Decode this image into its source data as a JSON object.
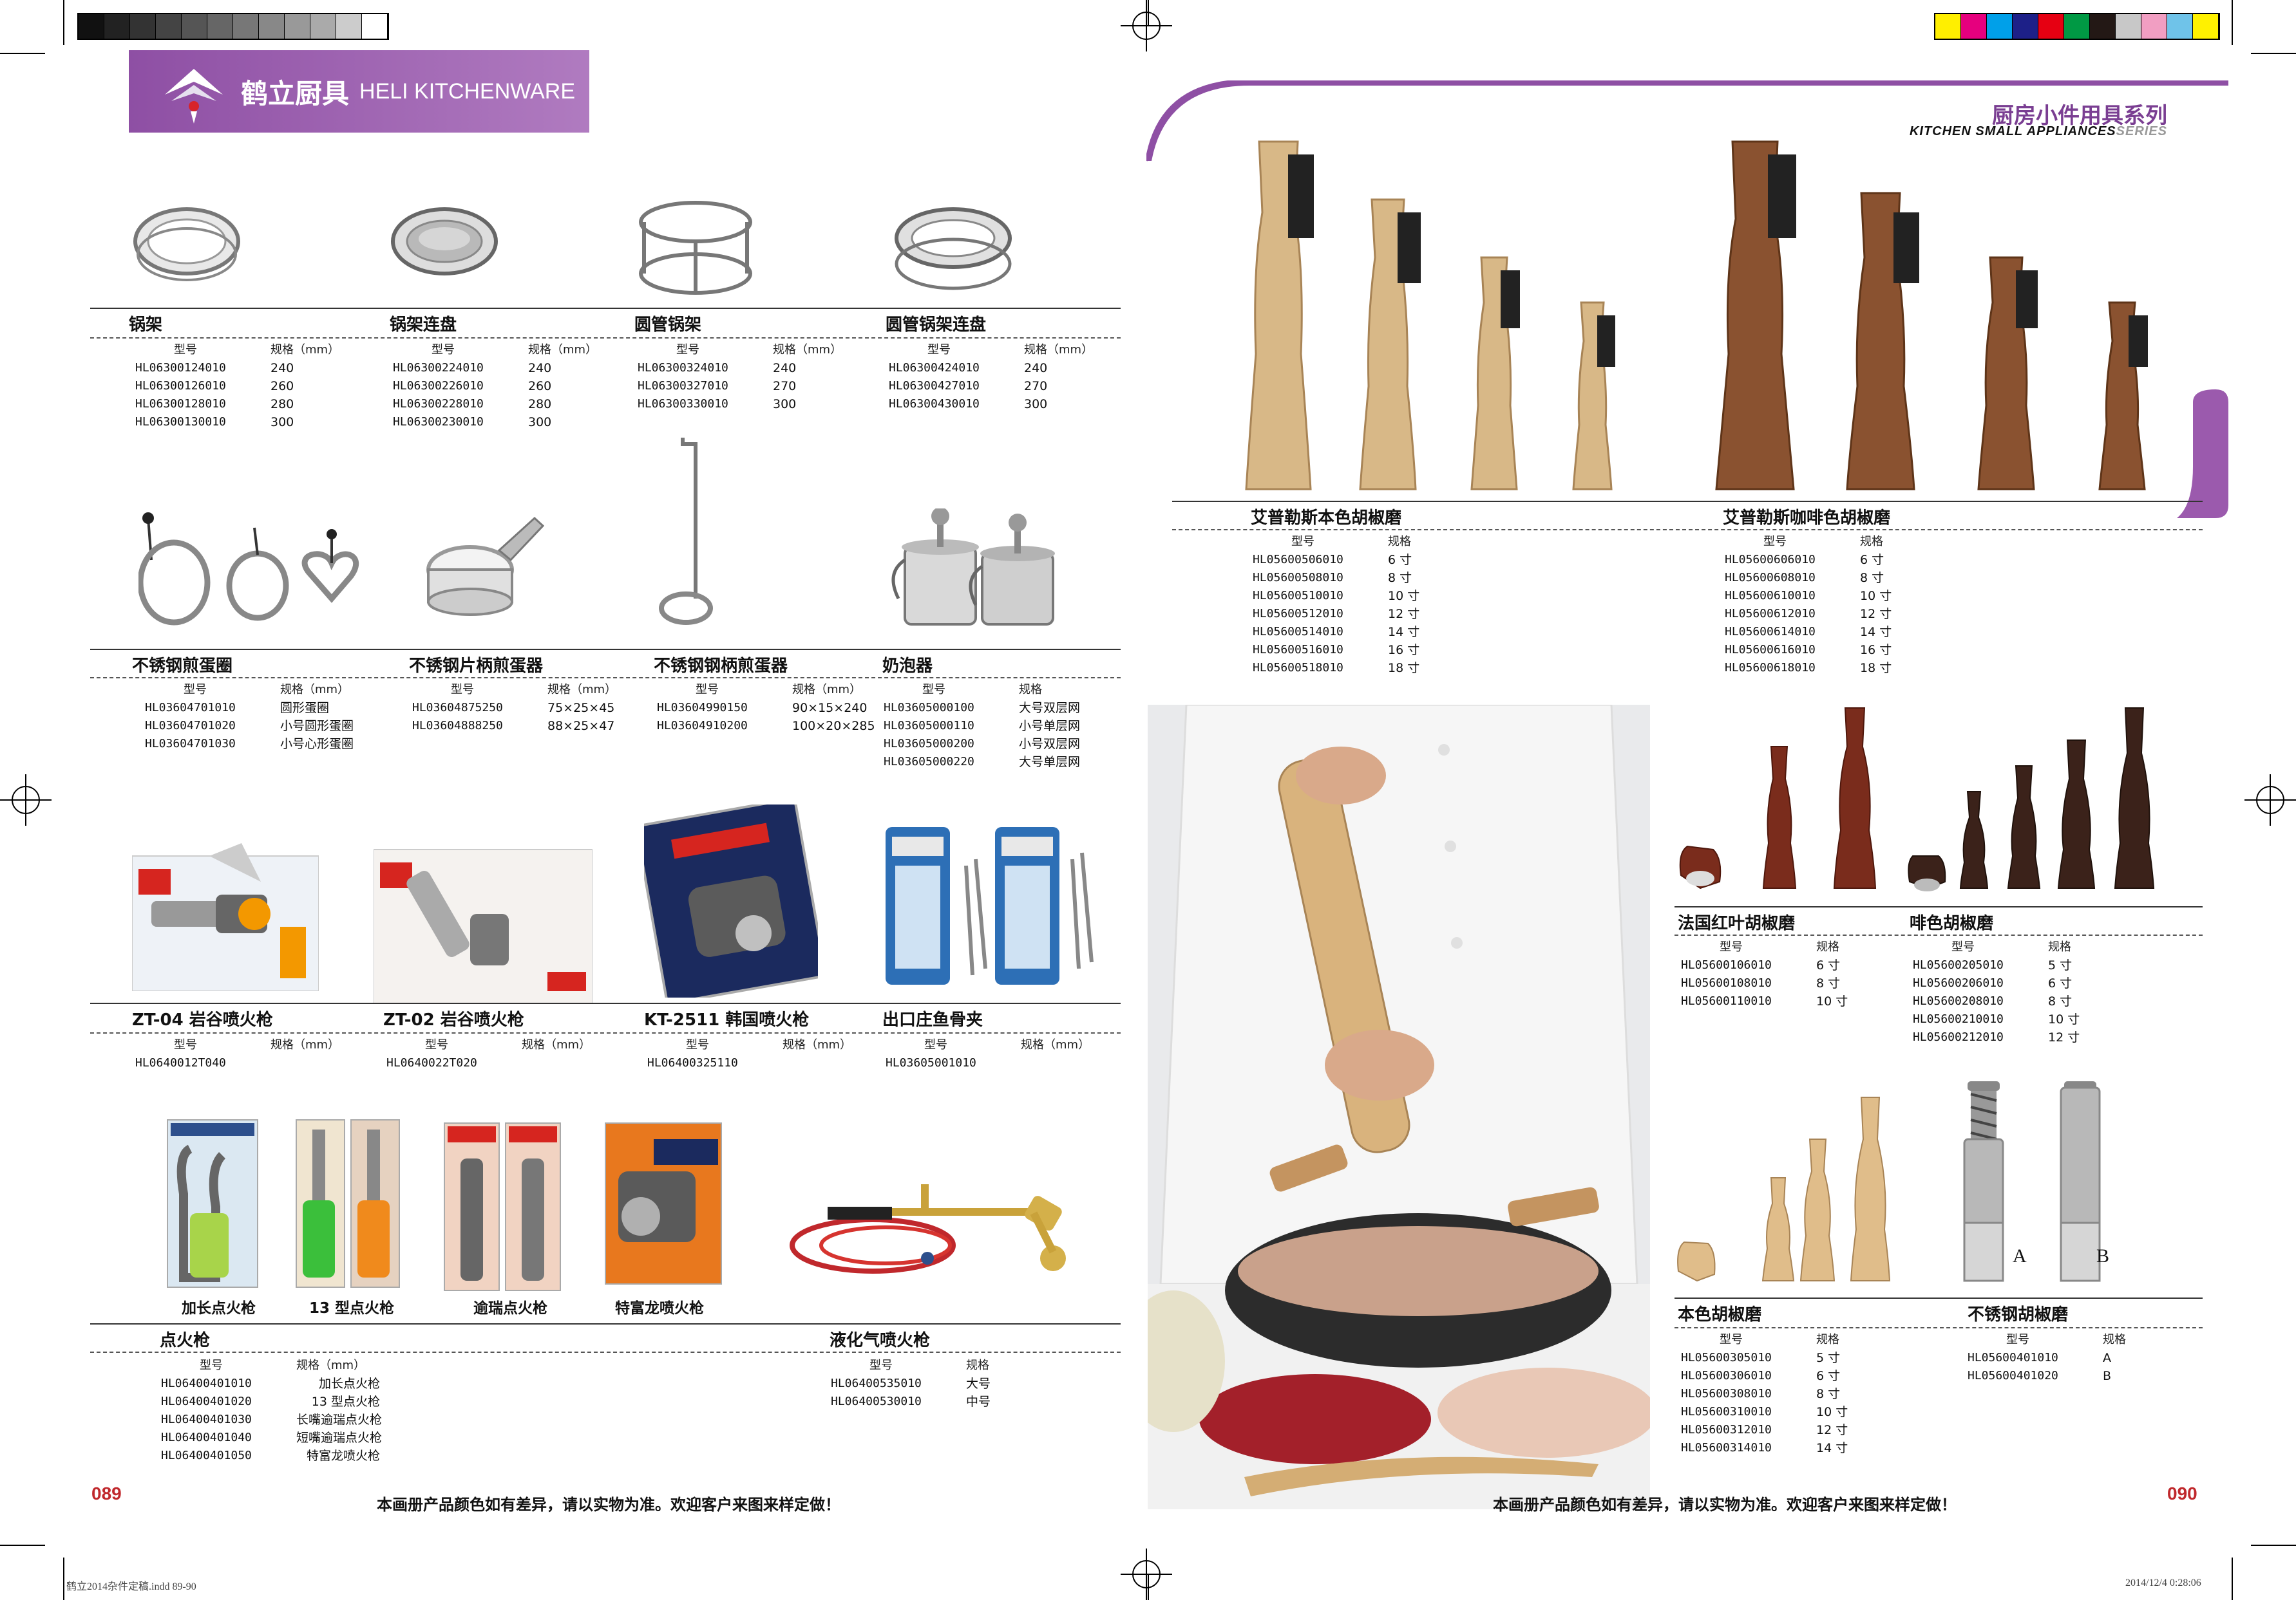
{
  "brand": {
    "name_cn": "鹤立厨具",
    "name_en": "HELI KITCHENWARE"
  },
  "series": {
    "title_cn": "厨房小件用具系列",
    "title_en": "KITCHEN SMALL APPLIANCES",
    "title_en_suffix": "SERIES"
  },
  "colors": {
    "accent": "#8e4fa4",
    "page_number": "#c0282c"
  },
  "spec_headers": {
    "model": "型号",
    "size_mm": "规格（mm）",
    "size": "规格"
  },
  "products": {
    "wok_rack": {
      "name": "锅架",
      "rows": [
        [
          "HL06300124010",
          "240"
        ],
        [
          "HL06300126010",
          "260"
        ],
        [
          "HL06300128010",
          "280"
        ],
        [
          "HL06300130010",
          "300"
        ]
      ]
    },
    "wok_rack_tray": {
      "name": "锅架连盘",
      "rows": [
        [
          "HL06300224010",
          "240"
        ],
        [
          "HL06300226010",
          "260"
        ],
        [
          "HL06300228010",
          "280"
        ],
        [
          "HL06300230010",
          "300"
        ]
      ]
    },
    "round_tube_rack": {
      "name": "圆管锅架",
      "rows": [
        [
          "HL06300324010",
          "240"
        ],
        [
          "HL06300327010",
          "270"
        ],
        [
          "HL06300330010",
          "300"
        ]
      ]
    },
    "round_tube_rack_tray": {
      "name": "圆管锅架连盘",
      "rows": [
        [
          "HL06300424010",
          "240"
        ],
        [
          "HL06300427010",
          "270"
        ],
        [
          "HL06300430010",
          "300"
        ]
      ]
    },
    "egg_ring": {
      "name": "不锈钢煎蛋圈",
      "rows": [
        [
          "HL03604701010",
          "圆形蛋圈"
        ],
        [
          "HL03604701020",
          "小号圆形蛋圈"
        ],
        [
          "HL03604701030",
          "小号心形蛋圈"
        ]
      ]
    },
    "egg_fryer_handle": {
      "name": "不锈钢片柄煎蛋器",
      "rows": [
        [
          "HL03604875250",
          "75×25×45"
        ],
        [
          "HL03604888250",
          "88×25×47"
        ]
      ]
    },
    "egg_fryer_long": {
      "name": "不锈钢钢柄煎蛋器",
      "rows": [
        [
          "HL03604990150",
          "90×15×240"
        ],
        [
          "HL03604910200",
          "100×20×285"
        ]
      ]
    },
    "milk_frother": {
      "name": "奶泡器",
      "rows": [
        [
          "HL03605000100",
          "大号双层网"
        ],
        [
          "HL03605000110",
          "小号单层网"
        ],
        [
          "HL03605000200",
          "小号双层网"
        ],
        [
          "HL03605000220",
          "大号单层网"
        ]
      ]
    },
    "torch_zt04": {
      "name": "ZT-04 岩谷喷火枪",
      "rows": [
        [
          "HL0640012T040",
          ""
        ]
      ]
    },
    "torch_zt02": {
      "name": "ZT-02 岩谷喷火枪",
      "rows": [
        [
          "HL0640022T020",
          ""
        ]
      ]
    },
    "torch_kt2511": {
      "name": "KT-2511 韩国喷火枪",
      "rows": [
        [
          "HL06400325110",
          ""
        ]
      ]
    },
    "fish_bone_clip": {
      "name": "出口庄鱼骨夹",
      "rows": [
        [
          "HL03605001010",
          ""
        ]
      ]
    },
    "lighter_captions": [
      "加长点火枪",
      "13 型点火枪",
      "逾瑞点火枪",
      "特富龙喷火枪"
    ],
    "lighter": {
      "name": "点火枪",
      "rows": [
        [
          "HL06400401010",
          "加长点火枪"
        ],
        [
          "HL06400401020",
          "13 型点火枪"
        ],
        [
          "HL06400401030",
          "长嘴逾瑞点火枪"
        ],
        [
          "HL06400401040",
          "短嘴逾瑞点火枪"
        ],
        [
          "HL06400401050",
          "特富龙喷火枪"
        ]
      ]
    },
    "lpg_torch": {
      "name": "液化气喷火枪",
      "rows": [
        [
          "HL06400535010",
          "大号"
        ],
        [
          "HL06400530010",
          "中号"
        ]
      ]
    },
    "natural_mill": {
      "name": "艾普勒斯本色胡椒磨",
      "rows": [
        [
          "HL05600506010",
          "6 寸"
        ],
        [
          "HL05600508010",
          "8 寸"
        ],
        [
          "HL05600510010",
          "10 寸"
        ],
        [
          "HL05600512010",
          "12 寸"
        ],
        [
          "HL05600514010",
          "14 寸"
        ],
        [
          "HL05600516010",
          "16 寸"
        ],
        [
          "HL05600518010",
          "18 寸"
        ]
      ]
    },
    "coffee_mill": {
      "name": "艾普勒斯咖啡色胡椒磨",
      "rows": [
        [
          "HL05600606010",
          "6 寸"
        ],
        [
          "HL05600608010",
          "8 寸"
        ],
        [
          "HL05600610010",
          "10 寸"
        ],
        [
          "HL05600612010",
          "12 寸"
        ],
        [
          "HL05600614010",
          "14 寸"
        ],
        [
          "HL05600616010",
          "16 寸"
        ],
        [
          "HL05600618010",
          "18 寸"
        ]
      ]
    },
    "french_red_mill": {
      "name": "法国红叶胡椒磨",
      "rows": [
        [
          "HL05600106010",
          "6 寸"
        ],
        [
          "HL05600108010",
          "8 寸"
        ],
        [
          "HL05600110010",
          "10 寸"
        ]
      ]
    },
    "coffee_color_mill": {
      "name": "啡色胡椒磨",
      "rows": [
        [
          "HL05600205010",
          "5 寸"
        ],
        [
          "HL05600206010",
          "6 寸"
        ],
        [
          "HL05600208010",
          "8 寸"
        ],
        [
          "HL05600210010",
          "10 寸"
        ],
        [
          "HL05600212010",
          "12 寸"
        ]
      ]
    },
    "plain_mill": {
      "name": "本色胡椒磨",
      "rows": [
        [
          "HL05600305010",
          "5 寸"
        ],
        [
          "HL05600306010",
          "6 寸"
        ],
        [
          "HL05600308010",
          "8 寸"
        ],
        [
          "HL05600310010",
          "10 寸"
        ],
        [
          "HL05600312010",
          "12 寸"
        ],
        [
          "HL05600314010",
          "14 寸"
        ]
      ]
    },
    "steel_mill": {
      "name": "不锈钢胡椒磨",
      "rows": [
        [
          "HL05600401010",
          "A"
        ],
        [
          "HL05600401020",
          "B"
        ]
      ],
      "labels": [
        "A",
        "B"
      ]
    }
  },
  "footer": {
    "page_left": "089",
    "page_right": "090",
    "notice": "本画册产品颜色如有差异，请以实物为准。欢迎客户来图来样定做！",
    "slug_left": "鹤立2014杂件定稿.indd   89-90",
    "slug_right": "2014/12/4   0:28:06"
  }
}
